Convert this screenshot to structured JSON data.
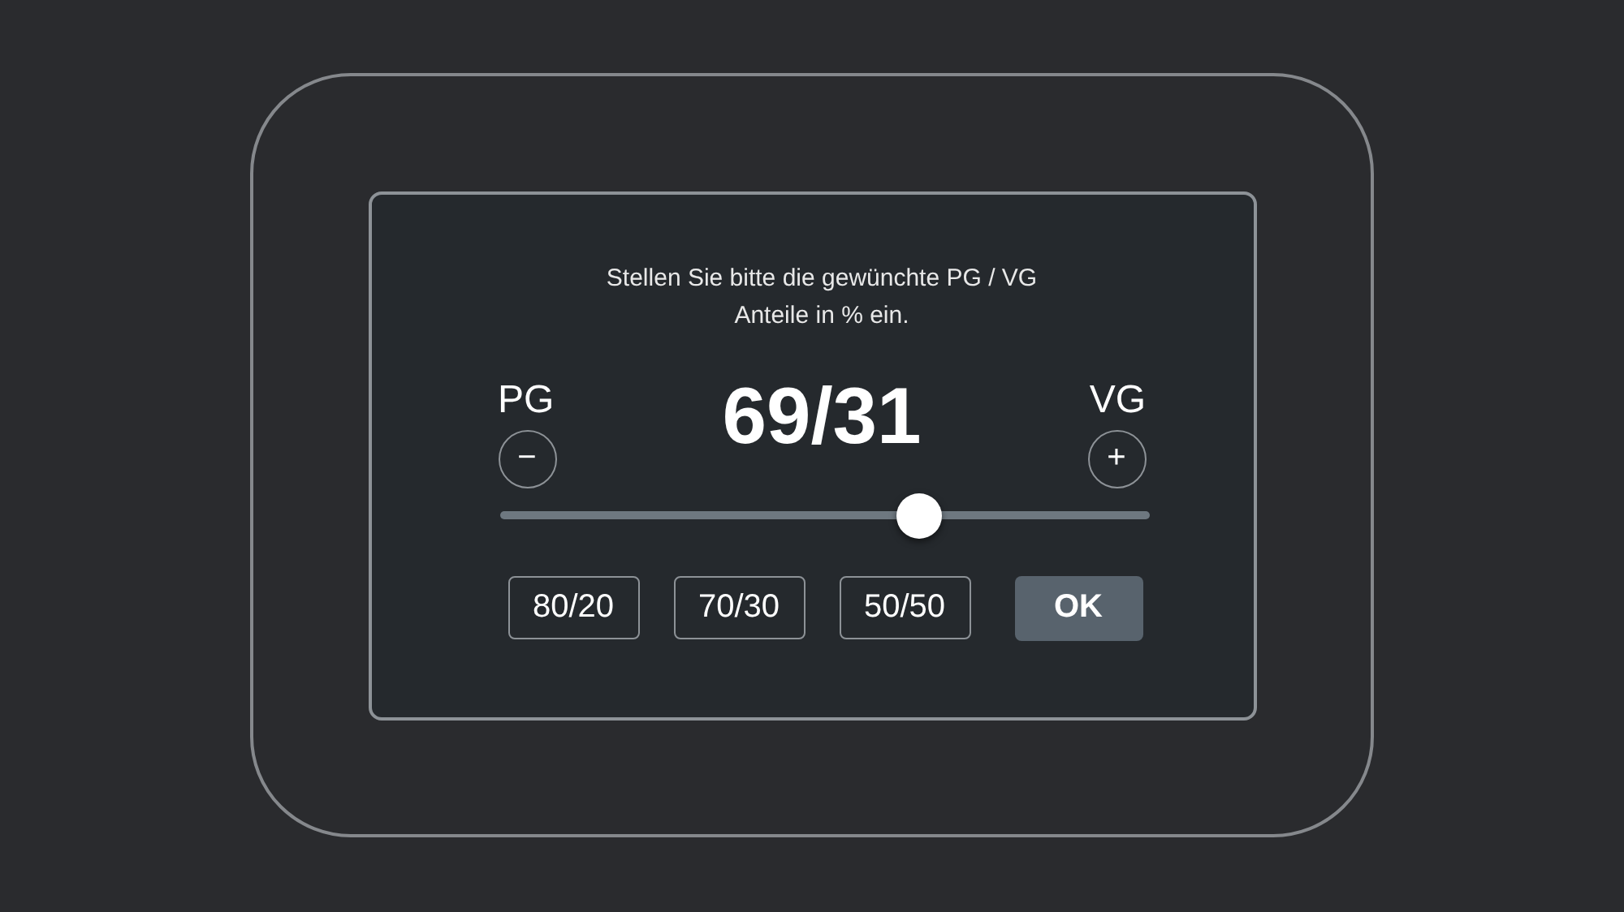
{
  "message": "Stellen Sie bitte die gewünchte PG / VG\nAnteile in % ein.",
  "left": {
    "label": "PG",
    "button": "−"
  },
  "value": "69/31",
  "right": {
    "label": "VG",
    "button": "+"
  },
  "slider": {
    "level": 0.645
  },
  "presets": [
    {
      "label": "80/20"
    },
    {
      "label": "70/30"
    },
    {
      "label": "50/50"
    }
  ],
  "ok": "OK"
}
